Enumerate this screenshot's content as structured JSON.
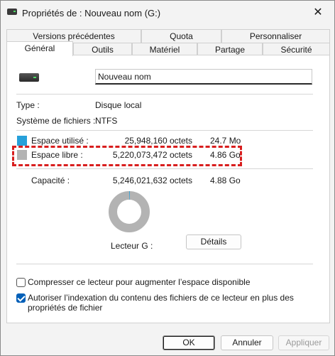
{
  "window": {
    "title": "Propriétés de : Nouveau nom (G:)",
    "close_glyph": "✕"
  },
  "tabs_row1": [
    "Versions précédentes",
    "Quota",
    "Personnaliser"
  ],
  "tabs_row2": [
    "Général",
    "Outils",
    "Matériel",
    "Partage",
    "Sécurité"
  ],
  "active_tab": "Général",
  "general": {
    "name_value": "Nouveau nom",
    "type_label": "Type :",
    "type_value": "Disque local",
    "fs_label": "Système de fichiers :",
    "fs_value": "NTFS",
    "used_label": "Espace utilisé :",
    "used_bytes": "25,948,160 octets",
    "used_human": "24.7 Mo",
    "free_label": "Espace libre :",
    "free_bytes": "5,220,073,472 octets",
    "free_human": "4.86 Go",
    "capacity_label": "Capacité :",
    "capacity_bytes": "5,246,021,632 octets",
    "capacity_human": "4.88 Go",
    "drive_label": "Lecteur G :",
    "details_button": "Détails",
    "used_fraction": 0.005,
    "used_color": "#26a0da",
    "free_color": "#b3b3b3",
    "compress_label": "Compresser ce lecteur pour augmenter l’espace disponible",
    "compress_checked": false,
    "index_label": "Autoriser l’indexation du contenu des fichiers de ce lecteur en plus des propriétés de fichier",
    "index_checked": true
  },
  "buttons": {
    "ok": "OK",
    "cancel": "Annuler",
    "apply": "Appliquer"
  },
  "highlight_color": "#d81e1e"
}
